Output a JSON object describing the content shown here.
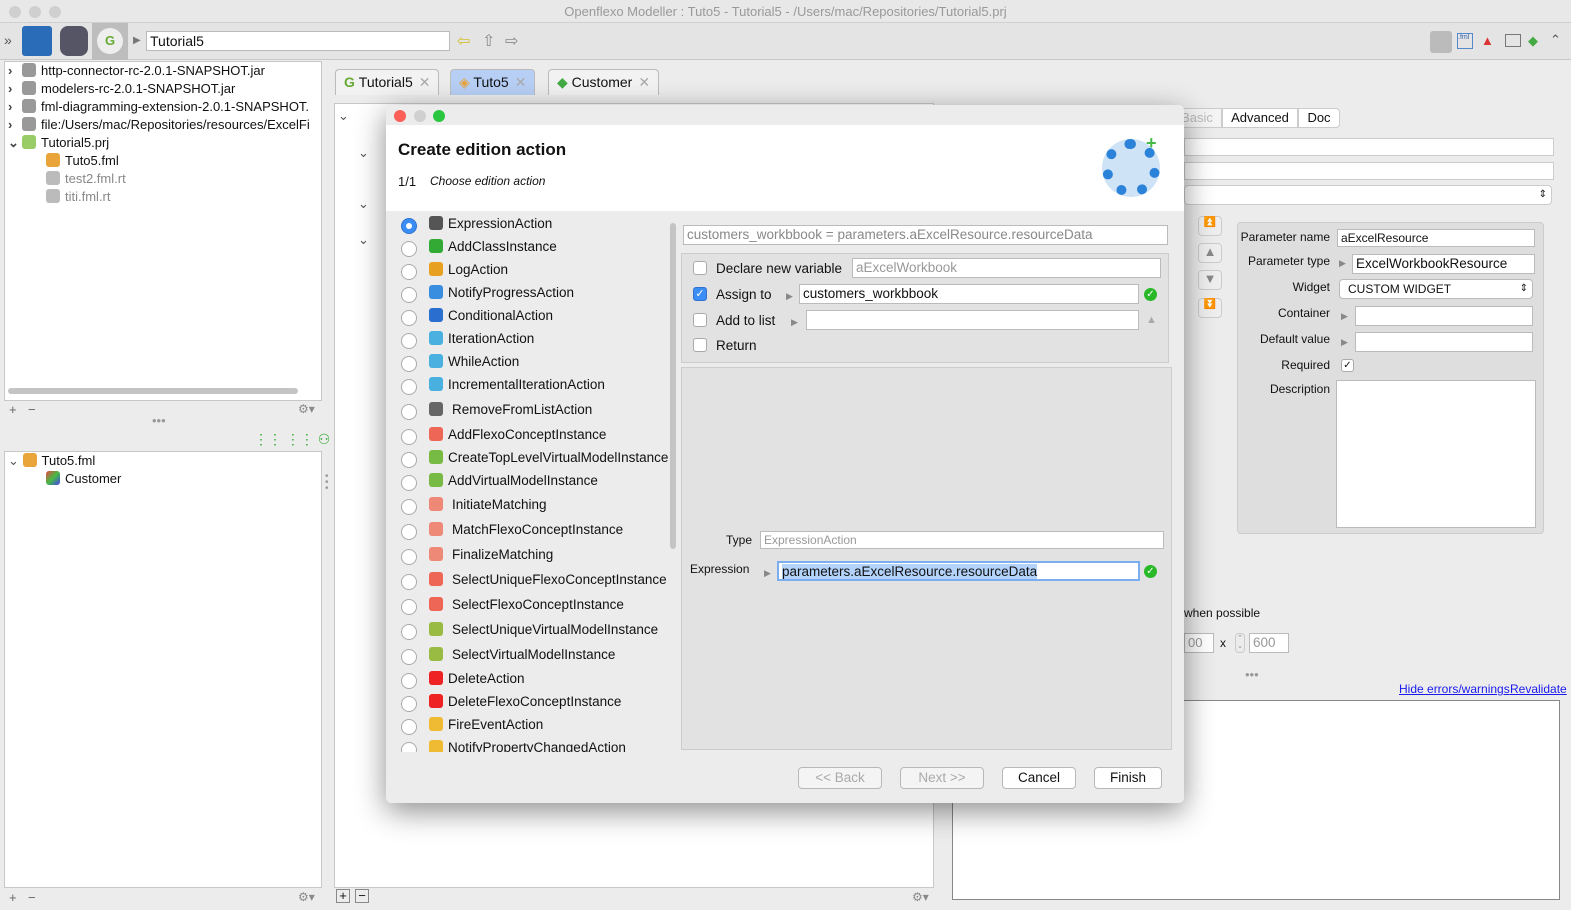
{
  "window": {
    "title": "Openflexo Modeller : Tuto5 - Tutorial5 - /Users/mac/Repositories/Tutorial5.prj"
  },
  "toolbar": {
    "path": "Tutorial5"
  },
  "project_tree": [
    {
      "label": "http-connector-rc-2.0.1-SNAPSHOT.jar",
      "icon": "jar-icon"
    },
    {
      "label": "modelers-rc-2.0.1-SNAPSHOT.jar",
      "icon": "jar-icon"
    },
    {
      "label": "fml-diagramming-extension-2.0.1-SNAPSHOT.",
      "icon": "jar-icon"
    },
    {
      "label": "file:/Users/mac/Repositories/resources/ExcelFi",
      "icon": "jar-icon"
    },
    {
      "label": "Tutorial5.prj",
      "icon": "project-icon"
    },
    {
      "label": "Tuto5.fml",
      "icon": "fml-icon"
    },
    {
      "label": "test2.fml.rt",
      "icon": "rt-icon"
    },
    {
      "label": "titi.fml.rt",
      "icon": "rt-icon"
    }
  ],
  "browser_tree": [
    {
      "label": "Tuto5.fml"
    },
    {
      "label": "Customer"
    }
  ],
  "tabs": [
    {
      "label": "Tutorial5"
    },
    {
      "label": "Tuto5"
    },
    {
      "label": "Customer"
    }
  ],
  "inspector": {
    "tabs": [
      "Basic",
      "Advanced",
      "Doc"
    ],
    "param_name_label": "Parameter name",
    "param_name": "aExcelResource",
    "param_type_label": "Parameter type",
    "param_type": "ExcelWorkbookResource",
    "widget_label": "Widget",
    "widget": "CUSTOM WIDGET",
    "container_label": "Container",
    "default_label": "Default value",
    "required_label": "Required",
    "description_label": "Description",
    "when_possible": "when possible",
    "width": "00",
    "x": "x",
    "height": "600",
    "hide_errors": "Hide errors/warnings",
    "revalidate": "Revalidate"
  },
  "dialog": {
    "title": "Create edition action",
    "step": "1/1",
    "step_label": "Choose edition action",
    "actions": [
      "ExpressionAction",
      "AddClassInstance",
      "LogAction",
      "NotifyProgressAction",
      "ConditionalAction",
      "IterationAction",
      "WhileAction",
      "IncrementalIterationAction",
      "RemoveFromListAction",
      "AddFlexoConceptInstance",
      "CreateTopLevelVirtualModelInstance",
      "AddVirtualModelInstance",
      "InitiateMatching",
      "MatchFlexoConceptInstance",
      "FinalizeMatching",
      "SelectUniqueFlexoConceptInstance",
      "SelectFlexoConceptInstance",
      "SelectUniqueVirtualModelInstance",
      "SelectVirtualModelInstance",
      "DeleteAction",
      "DeleteFlexoConceptInstance",
      "FireEventAction",
      "NotifyPropertyChangedAction"
    ],
    "selected": "ExpressionAction",
    "summary": "customers_workbbook = parameters.aExcelResource.resourceData",
    "declare_label": "Declare new variable",
    "declare_value": "aExcelWorkbook",
    "declare_checked": false,
    "assign_label": "Assign to",
    "assign_value": "customers_workbbook",
    "assign_checked": true,
    "add_list_label": "Add to list",
    "add_list_checked": false,
    "return_label": "Return",
    "return_checked": false,
    "type_label": "Type",
    "type_value": "ExpressionAction",
    "expression_label": "Expression",
    "expression_value": "parameters.aExcelResource.resourceData",
    "back": "<< Back",
    "next": "Next >>",
    "cancel": "Cancel",
    "finish": "Finish"
  },
  "colors": {
    "accent": "#3b8df5",
    "selected_tab": "#b7cff5",
    "ok": "#28b828",
    "link": "#1a1aee"
  }
}
